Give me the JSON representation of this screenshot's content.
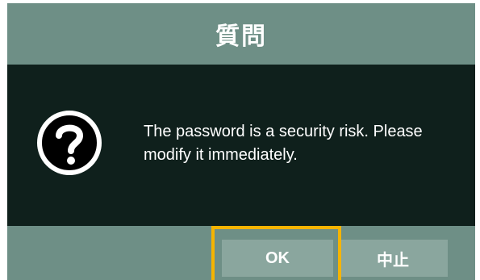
{
  "dialog": {
    "title": "質問",
    "message": "The password is a security risk. Please modify it immediately.",
    "icon": "question-icon"
  },
  "buttons": {
    "ok_label": "OK",
    "cancel_label": "中止"
  },
  "colors": {
    "title_bar": "#6e8f86",
    "body_background": "#0f201c",
    "button": "#8aa69e",
    "highlight": "#f5b400"
  }
}
